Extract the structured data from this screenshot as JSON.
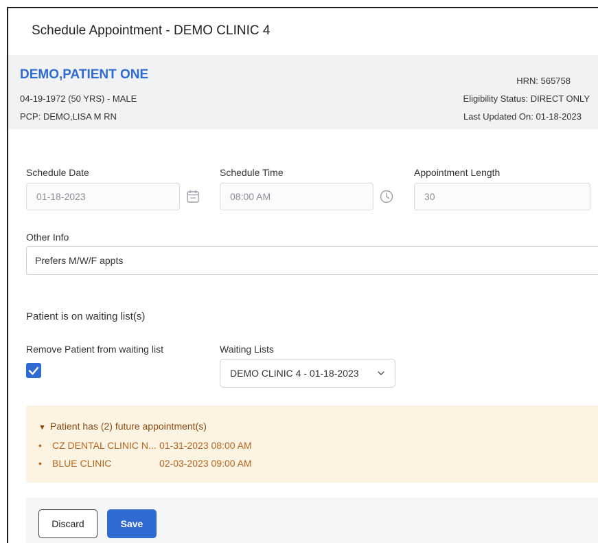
{
  "modal": {
    "title": "Schedule Appointment - DEMO CLINIC 4"
  },
  "patient": {
    "name": "DEMO,PATIENT ONE",
    "dob_line": "04-19-1972 (50 YRS) - MALE",
    "pcp_line": "PCP: DEMO,LISA M RN",
    "hrn": "HRN: 565758",
    "eligibility": "Eligibility Status: DIRECT ONLY",
    "last_updated": "Last Updated On: 01-18-2023"
  },
  "form": {
    "schedule_date": {
      "label": "Schedule Date",
      "value": "01-18-2023",
      "icon": "calendar-icon"
    },
    "schedule_time": {
      "label": "Schedule Time",
      "value": "08:00 AM",
      "icon": "clock-icon"
    },
    "appointment_length": {
      "label": "Appointment Length",
      "value": "30"
    },
    "other_info": {
      "label": "Other Info",
      "value": "Prefers M/W/F appts"
    }
  },
  "waiting": {
    "section_title": "Patient is on waiting list(s)",
    "remove_label": "Remove Patient from waiting list",
    "remove_checked": true,
    "lists_label": "Waiting Lists",
    "selected_list": "DEMO CLINIC 4 - 01-18-2023"
  },
  "future_appointments": {
    "summary": "Patient has (2) future appointment(s)",
    "items": [
      {
        "clinic": "CZ DENTAL CLINIC N...",
        "datetime": "01-31-2023 08:00 AM"
      },
      {
        "clinic": "BLUE CLINIC",
        "datetime": "02-03-2023 09:00 AM"
      }
    ]
  },
  "actions": {
    "discard_label": "Discard",
    "save_label": "Save"
  },
  "colors": {
    "accent": "#2f6bd1",
    "header_bg": "#f1f2f4",
    "appt_bg": "#fcf3e3",
    "appt_text": "#b5651d"
  }
}
